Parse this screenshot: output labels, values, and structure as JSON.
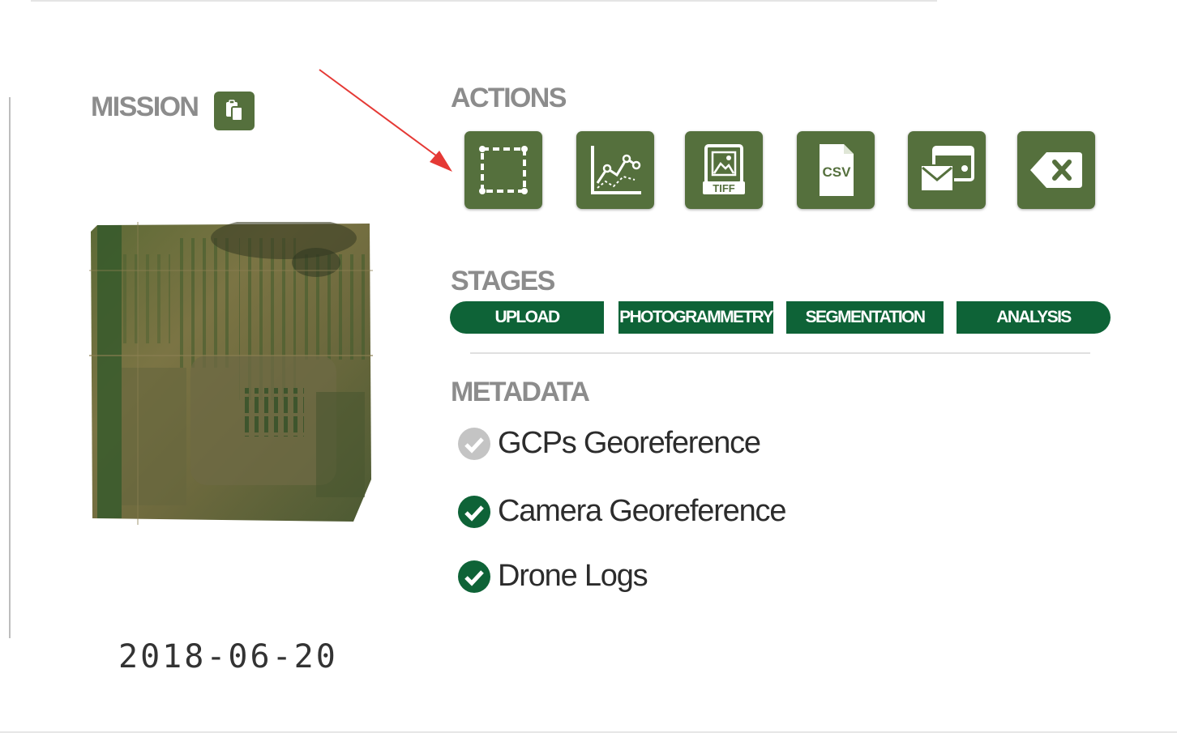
{
  "mission": {
    "label": "MISSION",
    "copy_icon": "clipboard-copy-icon",
    "thumbnail": "orthomosaic-field-thumbnail",
    "date": "2018-06-20"
  },
  "actions": {
    "label": "ACTIONS",
    "buttons": [
      {
        "icon": "crop-selection-icon"
      },
      {
        "icon": "line-chart-icon"
      },
      {
        "icon": "tiff-image-icon",
        "text": "TIFF"
      },
      {
        "icon": "csv-file-icon",
        "text": "CSV"
      },
      {
        "icon": "email-share-icon"
      },
      {
        "icon": "delete-backspace-icon"
      }
    ]
  },
  "stages": {
    "label": "STAGES",
    "items": [
      {
        "label": "UPLOAD"
      },
      {
        "label": "PHOTOGRAMMETRY"
      },
      {
        "label": "SEGMENTATION"
      },
      {
        "label": "ANALYSIS"
      }
    ]
  },
  "metadata": {
    "label": "METADATA",
    "items": [
      {
        "label": "GCPs Georeference",
        "status": "inactive"
      },
      {
        "label": "Camera Georeference",
        "status": "complete"
      },
      {
        "label": "Drone Logs",
        "status": "complete"
      }
    ]
  },
  "colors": {
    "action_green": "#55703d",
    "stage_green": "#0e6337",
    "check_green": "#0e6337",
    "check_inactive": "#c4c4c4",
    "annotation_arrow": "#e53935"
  }
}
